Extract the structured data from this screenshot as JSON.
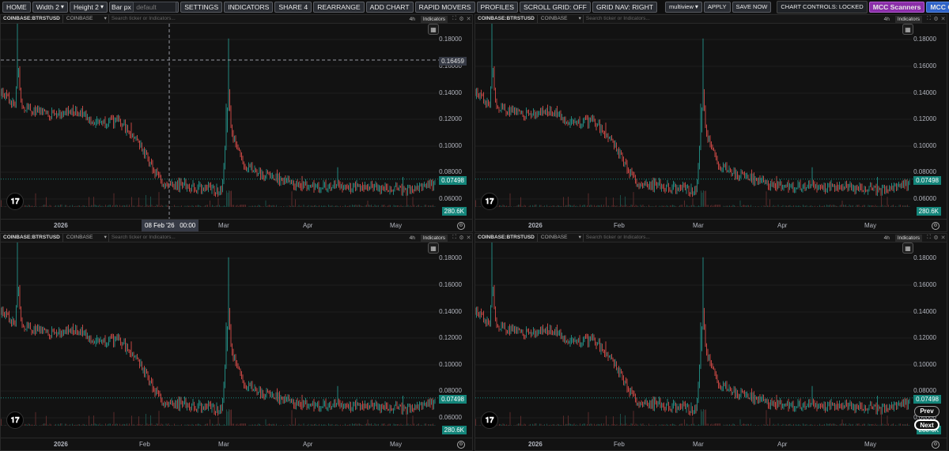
{
  "toolbar": {
    "home": "HOME",
    "width_label": "Width",
    "width_value": "2",
    "height_label": "Height",
    "height_value": "2",
    "barpx_label": "Bar px",
    "barpx_placeholder": "default",
    "settings": "SETTINGS",
    "indicators": "INDICATORS",
    "share": "SHARE 4",
    "rearrange": "REARRANGE",
    "add_chart": "ADD CHART",
    "rapid_movers": "RAPID MOVERS",
    "profiles": "PROFILES",
    "scroll_grid": "SCROLL GRID: OFF",
    "grid_nav": "GRID NAV: RIGHT",
    "layout_select": "multiview",
    "apply": "APPLY",
    "save_now": "SAVE NOW",
    "chart_controls": "CHART CONTROLS: LOCKED",
    "mcc_scanners": "MCC Scanners",
    "mcc_community": "MCC Community",
    "status_color": "#2ecc71"
  },
  "charts": [
    {
      "symbol": "COINBASE:BTRSTUSD",
      "exchange": "COINBASE",
      "search_placeholder": "Search ticker or Indicators...",
      "timeframe": "4h",
      "indicators": "Indicators",
      "price_ticks": [
        "0.18000",
        "0.16000",
        "0.14000",
        "0.12000",
        "0.10000",
        "0.08000",
        "0.06000"
      ],
      "last_price": "0.07498",
      "volume": "280.6K",
      "crosshair_price": "0.16459",
      "crosshair_time": "08 Feb '26   00:00",
      "time_labels": [
        "2026",
        "Mar",
        "Apr",
        "May"
      ]
    },
    {
      "symbol": "COINBASE:BTRSTUSD",
      "exchange": "COINBASE",
      "search_placeholder": "Search ticker or Indicators...",
      "timeframe": "4h",
      "indicators": "Indicators",
      "price_ticks": [
        "0.18000",
        "0.16000",
        "0.14000",
        "0.12000",
        "0.10000",
        "0.08000",
        "0.06000"
      ],
      "last_price": "0.07498",
      "volume": "280.6K",
      "time_labels": [
        "2026",
        "Feb",
        "Mar",
        "Apr",
        "May"
      ]
    },
    {
      "symbol": "COINBASE:BTRSTUSD",
      "exchange": "COINBASE",
      "search_placeholder": "Search ticker or Indicators...",
      "timeframe": "4h",
      "indicators": "Indicators",
      "price_ticks": [
        "0.18000",
        "0.16000",
        "0.14000",
        "0.12000",
        "0.10000",
        "0.08000",
        "0.06000"
      ],
      "last_price": "0.07498",
      "volume": "280.6K",
      "time_labels": [
        "2026",
        "Feb",
        "Mar",
        "Apr",
        "May"
      ]
    },
    {
      "symbol": "COINBASE:BTRSTUSD",
      "exchange": "COINBASE",
      "search_placeholder": "Search ticker or Indicators...",
      "timeframe": "4h",
      "indicators": "Indicators",
      "price_ticks": [
        "0.18000",
        "0.16000",
        "0.14000",
        "0.12000",
        "0.10000",
        "0.08000",
        "0.06000"
      ],
      "last_price": "0.07498",
      "volume": "280.6K",
      "time_labels": [
        "2026",
        "Feb",
        "Mar",
        "Apr",
        "May"
      ],
      "prev": "Prev",
      "next": "Next"
    }
  ],
  "colors": {
    "up": "#26a69a",
    "down": "#ef5350",
    "price_tag": "#14857a"
  }
}
